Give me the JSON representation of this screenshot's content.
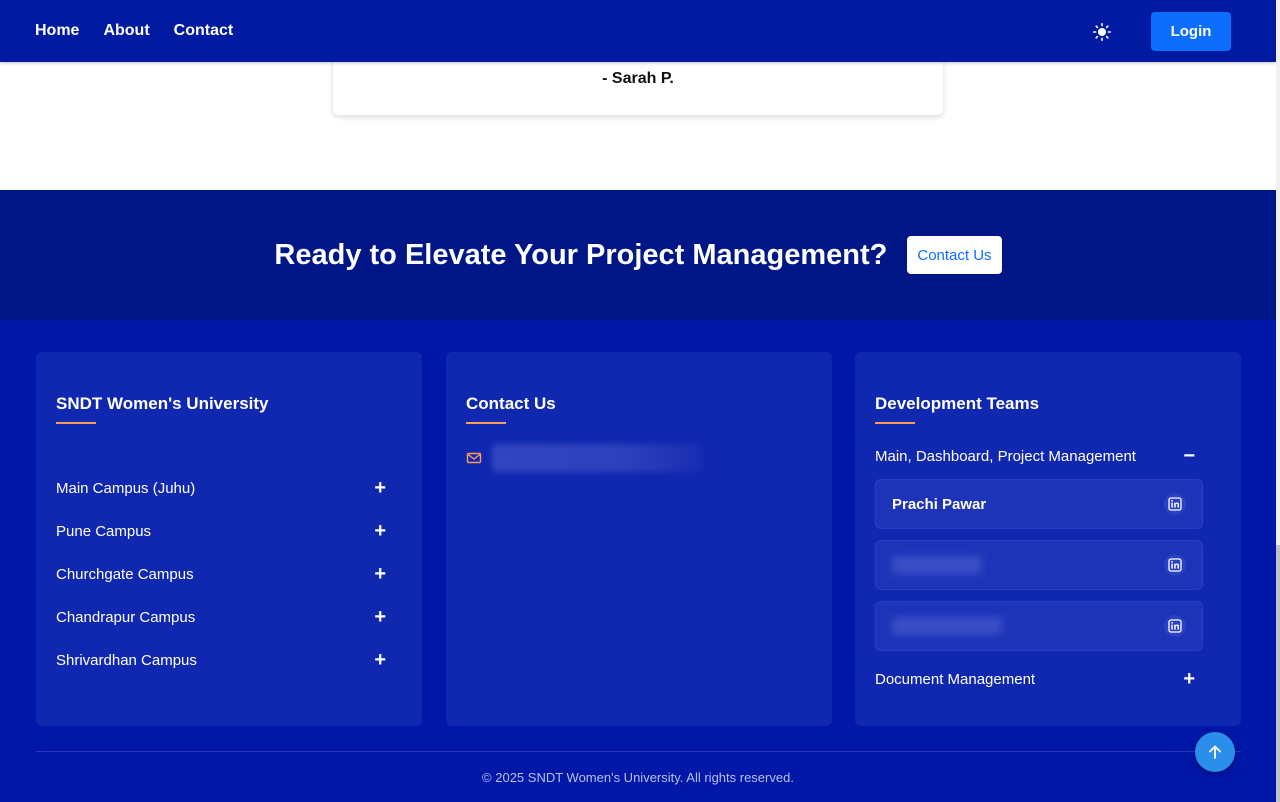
{
  "nav": {
    "links": [
      "Home",
      "About",
      "Contact"
    ],
    "login_label": "Login",
    "theme_icon": "sun-icon"
  },
  "testimonial": {
    "author": "- Sarah P."
  },
  "cta": {
    "title": "Ready to Elevate Your Project Management?",
    "button_label": "Contact Us"
  },
  "footer": {
    "university": {
      "title": "SNDT Women's University",
      "campuses": [
        "Main Campus (Juhu)",
        "Pune Campus",
        "Churchgate Campus",
        "Chandrapur Campus",
        "Shrivardhan Campus"
      ]
    },
    "contact": {
      "title": "Contact Us",
      "email_icon": "mail-icon"
    },
    "teams": {
      "title": "Development Teams",
      "groups": [
        {
          "label": "Main, Dashboard, Project Management",
          "expanded": true,
          "members": [
            "Prachi Pawar"
          ]
        },
        {
          "label": "Document Management",
          "expanded": false
        }
      ]
    },
    "copyright": "© 2025 SNDT Women's University. All rights reserved."
  },
  "colors": {
    "navbar": "#001ba1",
    "cta_bg": "#001687",
    "footer_bg": "#0017a8",
    "accent_underline": "#ff9a5a",
    "primary_button": "#0d6efd"
  }
}
